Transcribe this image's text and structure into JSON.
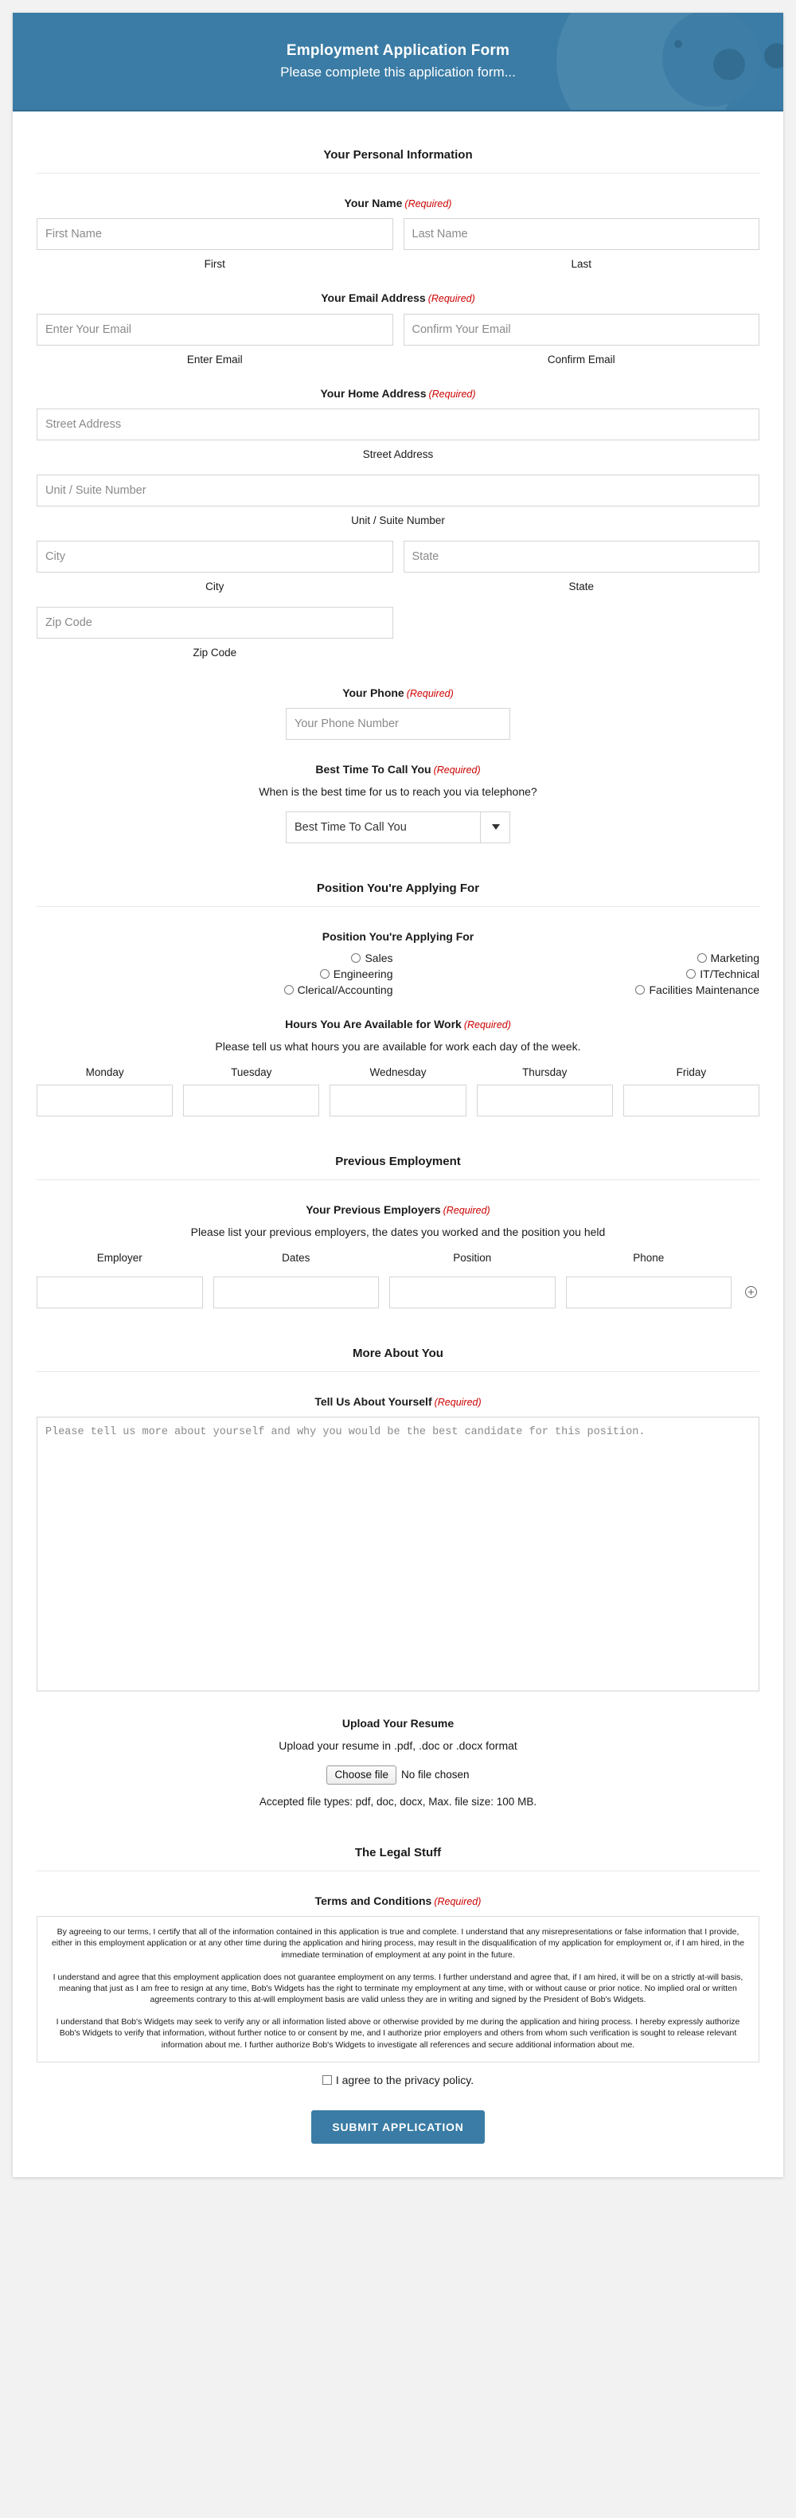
{
  "theme": {
    "accent": "#3a7ca5",
    "required_color": "#cc0000",
    "page_bg": "#f2f2f2",
    "card_bg": "#ffffff",
    "border": "#d4d4d4"
  },
  "header": {
    "title": "Employment Application Form",
    "subtitle": "Please complete this application form...",
    "decoration": "circles-pattern"
  },
  "required_tag": "(Required)",
  "sections": {
    "personal": {
      "title": "Your Personal Information"
    },
    "position": {
      "title": "Position You're Applying For"
    },
    "previous": {
      "title": "Previous Employment"
    },
    "more": {
      "title": "More About You"
    },
    "legal": {
      "title": "The Legal Stuff"
    }
  },
  "name": {
    "legend": "Your Name",
    "first_placeholder": "First Name",
    "last_placeholder": "Last Name",
    "first_sublabel": "First",
    "last_sublabel": "Last"
  },
  "email": {
    "legend": "Your Email Address",
    "email_placeholder": "Enter Your Email",
    "confirm_placeholder": "Confirm Your Email",
    "email_sublabel": "Enter Email",
    "confirm_sublabel": "Confirm Email"
  },
  "address": {
    "legend": "Your Home Address",
    "street_placeholder": "Street Address",
    "street_sublabel": "Street Address",
    "unit_placeholder": "Unit / Suite Number",
    "unit_sublabel": "Unit / Suite Number",
    "city_placeholder": "City",
    "city_sublabel": "City",
    "state_placeholder": "State",
    "state_sublabel": "State",
    "zip_placeholder": "Zip Code",
    "zip_sublabel": "Zip Code"
  },
  "phone": {
    "legend": "Your Phone",
    "placeholder": "Your Phone Number"
  },
  "best_time": {
    "legend": "Best Time To Call You",
    "description": "When is the best time for us to reach you via telephone?",
    "selected": "Best Time To Call You"
  },
  "position_field": {
    "legend": "Position You're Applying For",
    "left_options": [
      "Sales",
      "Engineering",
      "Clerical/Accounting"
    ],
    "right_options": [
      "Marketing",
      "IT/Technical",
      "Facilities Maintenance"
    ]
  },
  "hours": {
    "legend": "Hours You Are Available for Work",
    "description": "Please tell us what hours you are available for work each day of the week.",
    "days": [
      "Monday",
      "Tuesday",
      "Wednesday",
      "Thursday",
      "Friday"
    ]
  },
  "employers": {
    "legend": "Your Previous Employers",
    "description": "Please list your previous employers, the dates you worked and the position you held",
    "columns": [
      "Employer",
      "Dates",
      "Position",
      "Phone"
    ],
    "add_row_icon": "plus-circle-icon"
  },
  "about": {
    "legend": "Tell Us About Yourself",
    "placeholder": "Please tell us more about yourself and why you would be the best candidate for this position."
  },
  "upload": {
    "legend": "Upload Your Resume",
    "description": "Upload your resume in .pdf, .doc or .docx format",
    "button_label": "Choose file",
    "file_status": "No file chosen",
    "note": "Accepted file types: pdf, doc, docx, Max. file size: 100 MB."
  },
  "terms": {
    "legend": "Terms and Conditions",
    "paragraphs": [
      "By agreeing to our terms, I certify that all of the information contained in this application is true and complete. I understand that any misrepresentations or false information that I provide, either in this employment application or at any other time during the application and hiring process, may result in the disqualification of my application for employment or, if I am hired, in the immediate termination of employment at any point in the future.",
      "I understand and agree that this employment application does not guarantee employment on any terms. I further understand and agree that, if I am hired, it will be on a strictly at-will basis, meaning that just as I am free to resign at any time, Bob's Widgets has the right to terminate my employment at any time, with or without cause or prior notice. No implied oral or written agreements contrary to this at-will employment basis are valid unless they are in writing and signed by the President of Bob's Widgets.",
      "I understand that Bob's Widgets may seek to verify any or all information listed above or otherwise provided by me during the application and hiring process. I hereby expressly authorize Bob's Widgets to verify that information, without further notice to or consent by me, and I authorize prior employers and others from whom such verification is sought to release relevant information about me. I further authorize Bob's Widgets to investigate all references and secure additional information about me."
    ],
    "agree_label": "I agree to the privacy policy."
  },
  "submit": {
    "label": "SUBMIT APPLICATION"
  }
}
